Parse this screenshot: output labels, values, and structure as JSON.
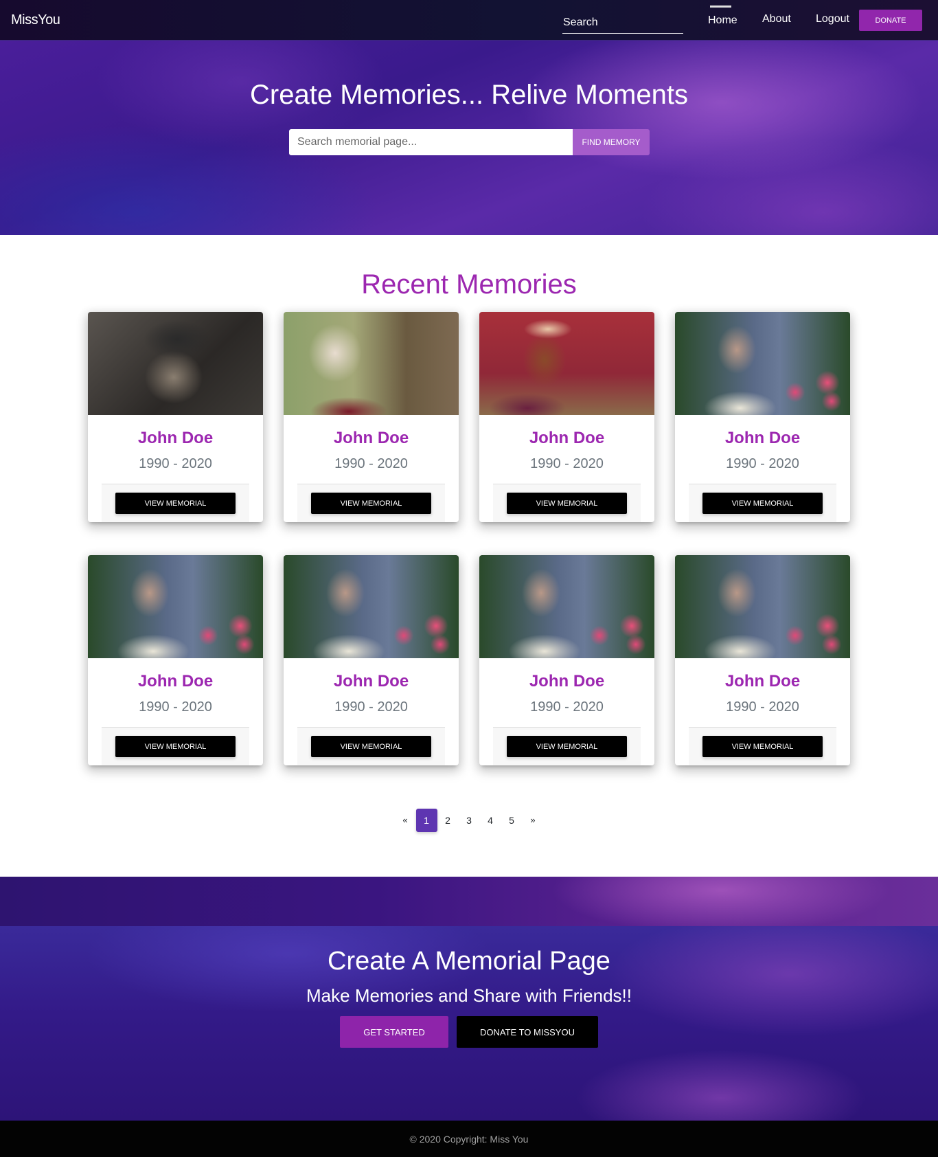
{
  "navbar": {
    "brand": "MissYou",
    "search_placeholder": "Search",
    "links": [
      {
        "label": "Home",
        "active": true
      },
      {
        "label": "About",
        "active": false
      },
      {
        "label": "Logout",
        "active": false
      }
    ],
    "donate_label": "DONATE"
  },
  "hero": {
    "title": "Create Memories... Relive Moments",
    "search_placeholder": "Search memorial page...",
    "find_button": "FIND MEMORY"
  },
  "recent": {
    "title": "Recent Memories",
    "cards": [
      {
        "name": "John Doe",
        "years": "1990 - 2020",
        "button": "VIEW MEMORIAL",
        "image": "man-in-cap-photo"
      },
      {
        "name": "John Doe",
        "years": "1990 - 2020",
        "button": "VIEW MEMORIAL",
        "image": "elderly-woman-tree-photo"
      },
      {
        "name": "John Doe",
        "years": "1990 - 2020",
        "button": "VIEW MEMORIAL",
        "image": "elderly-woman-headscarf-photo"
      },
      {
        "name": "John Doe",
        "years": "1990 - 2020",
        "button": "VIEW MEMORIAL",
        "image": "elderly-woman-flowers-photo"
      },
      {
        "name": "John Doe",
        "years": "1990 - 2020",
        "button": "VIEW MEMORIAL",
        "image": "elderly-woman-flowers-photo"
      },
      {
        "name": "John Doe",
        "years": "1990 - 2020",
        "button": "VIEW MEMORIAL",
        "image": "elderly-woman-flowers-photo"
      },
      {
        "name": "John Doe",
        "years": "1990 - 2020",
        "button": "VIEW MEMORIAL",
        "image": "elderly-woman-flowers-photo"
      },
      {
        "name": "John Doe",
        "years": "1990 - 2020",
        "button": "VIEW MEMORIAL",
        "image": "elderly-woman-flowers-photo"
      }
    ]
  },
  "pagination": {
    "prev": "«",
    "pages": [
      "1",
      "2",
      "3",
      "4",
      "5"
    ],
    "active_page": "1",
    "next": "»"
  },
  "cta": {
    "title": "Create A Memorial Page",
    "subtitle": "Make Memories and Share with Friends!!",
    "get_started": "GET STARTED",
    "donate": "DONATE TO MISSYOU"
  },
  "footer": {
    "copyright": "© 2020 Copyright: Miss You"
  },
  "colors": {
    "accent": "#9c27b0",
    "donate_button": "#9126ac",
    "find_button": "#a55ccb",
    "pagination_active": "#5e35b1",
    "footer_bg": "#030303"
  }
}
